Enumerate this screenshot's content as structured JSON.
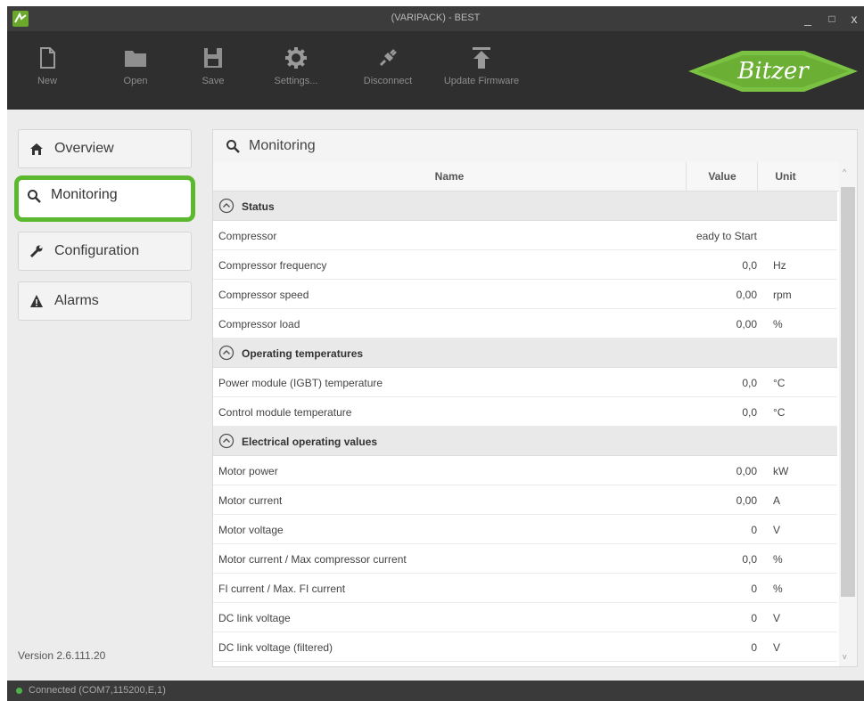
{
  "window": {
    "title": "(VARIPACK) - BEST",
    "minimize": "_",
    "maximize": "□",
    "close": "x"
  },
  "toolbar": {
    "items": [
      {
        "label": "New",
        "icon": "new-file-icon"
      },
      {
        "label": "Open",
        "icon": "folder-icon"
      },
      {
        "label": "Save",
        "icon": "save-icon"
      },
      {
        "label": "Settings...",
        "icon": "gear-icon"
      },
      {
        "label": "Disconnect",
        "icon": "plug-icon"
      },
      {
        "label": "Update Firmware",
        "icon": "upload-icon"
      }
    ],
    "logo": "Bitzer",
    "brand_color": "#7bc142"
  },
  "nav": {
    "items": [
      {
        "label": "Overview",
        "icon": "home-icon"
      },
      {
        "label": "Monitoring",
        "icon": "search-icon",
        "active": true
      },
      {
        "label": "Configuration",
        "icon": "wrench-icon"
      },
      {
        "label": "Alarms",
        "icon": "warning-icon"
      }
    ],
    "active_color": "#5cb82e"
  },
  "version": "Version 2.6.111.20",
  "panel": {
    "title": "Monitoring",
    "columns": {
      "name": "Name",
      "value": "Value",
      "unit": "Unit"
    },
    "groups": [
      {
        "name": "Status",
        "rows": [
          {
            "name": "Compressor",
            "value": "eady to Start",
            "unit": ""
          },
          {
            "name": "Compressor frequency",
            "value": "0,0",
            "unit": "Hz"
          },
          {
            "name": "Compressor speed",
            "value": "0,00",
            "unit": "rpm"
          },
          {
            "name": "Compressor load",
            "value": "0,00",
            "unit": "%"
          }
        ]
      },
      {
        "name": "Operating temperatures",
        "rows": [
          {
            "name": "Power module (IGBT) temperature",
            "value": "0,0",
            "unit": "°C"
          },
          {
            "name": "Control module temperature",
            "value": "0,0",
            "unit": "°C"
          }
        ]
      },
      {
        "name": "Electrical operating values",
        "rows": [
          {
            "name": "Motor power",
            "value": "0,00",
            "unit": "kW"
          },
          {
            "name": "Motor current",
            "value": "0,00",
            "unit": "A"
          },
          {
            "name": "Motor voltage",
            "value": "0",
            "unit": "V"
          },
          {
            "name": "Motor current / Max compressor current",
            "value": "0,0",
            "unit": "%"
          },
          {
            "name": "FI current / Max. FI current",
            "value": "0",
            "unit": "%"
          },
          {
            "name": "DC link voltage",
            "value": "0",
            "unit": "V"
          },
          {
            "name": "DC link voltage (filtered)",
            "value": "0",
            "unit": "V"
          }
        ]
      }
    ]
  },
  "status": {
    "text": "Connected (COM7,115200,E,1)",
    "led_color": "#4db348"
  }
}
